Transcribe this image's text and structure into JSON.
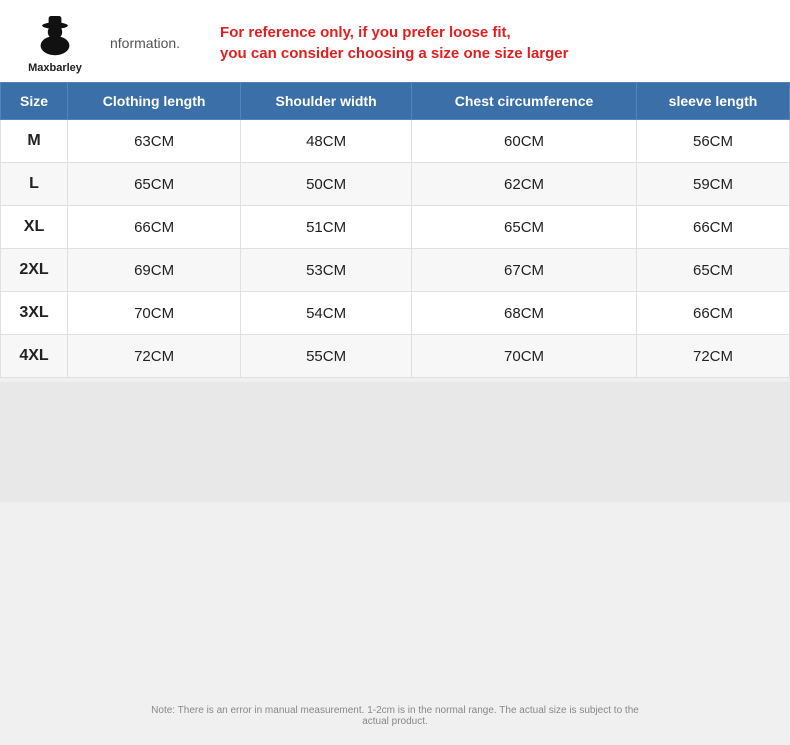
{
  "brand": {
    "name": "Maxbarley",
    "logo_alt": "Maxbarley logo with hat"
  },
  "header": {
    "info_text": "nformation.",
    "note_line1": "For reference only, if you prefer loose fit,",
    "note_line2": "you can consider choosing a size one size larger"
  },
  "table": {
    "columns": [
      "Size",
      "Clothing length",
      "Shoulder width",
      "Chest circumference",
      "sleeve length"
    ],
    "rows": [
      {
        "size": "M",
        "clothing_length": "63CM",
        "shoulder_width": "48CM",
        "chest_circumference": "60CM",
        "sleeve_length": "56CM"
      },
      {
        "size": "L",
        "clothing_length": "65CM",
        "shoulder_width": "50CM",
        "chest_circumference": "62CM",
        "sleeve_length": "59CM"
      },
      {
        "size": "XL",
        "clothing_length": "66CM",
        "shoulder_width": "51CM",
        "chest_circumference": "65CM",
        "sleeve_length": "66CM"
      },
      {
        "size": "2XL",
        "clothing_length": "69CM",
        "shoulder_width": "53CM",
        "chest_circumference": "67CM",
        "sleeve_length": "65CM"
      },
      {
        "size": "3XL",
        "clothing_length": "70CM",
        "shoulder_width": "54CM",
        "chest_circumference": "68CM",
        "sleeve_length": "66CM"
      },
      {
        "size": "4XL",
        "clothing_length": "72CM",
        "shoulder_width": "55CM",
        "chest_circumference": "70CM",
        "sleeve_length": "72CM"
      }
    ]
  },
  "footer": {
    "note": "Note: There is an error in manual measurement. 1-2cm is in the normal range. The actual size is subject to the actual product."
  }
}
